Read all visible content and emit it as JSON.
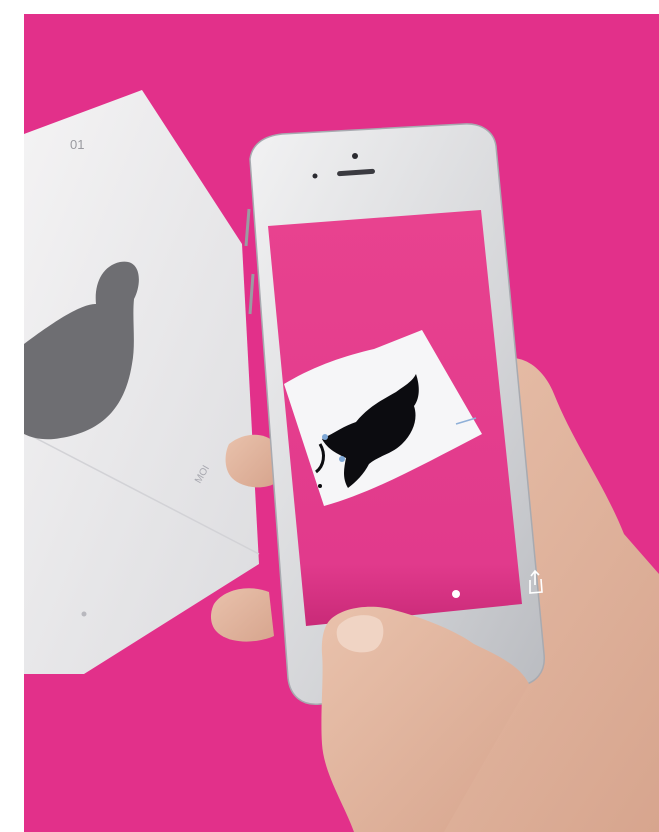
{
  "scene": {
    "background_color": "#e2308a",
    "booklet": {
      "page_number": "01",
      "side_text": "MOI"
    },
    "phone": {
      "screen_color": "#e5378f",
      "home_button": "round",
      "status_dot_count": 1
    },
    "icons": [
      "share-icon"
    ]
  }
}
